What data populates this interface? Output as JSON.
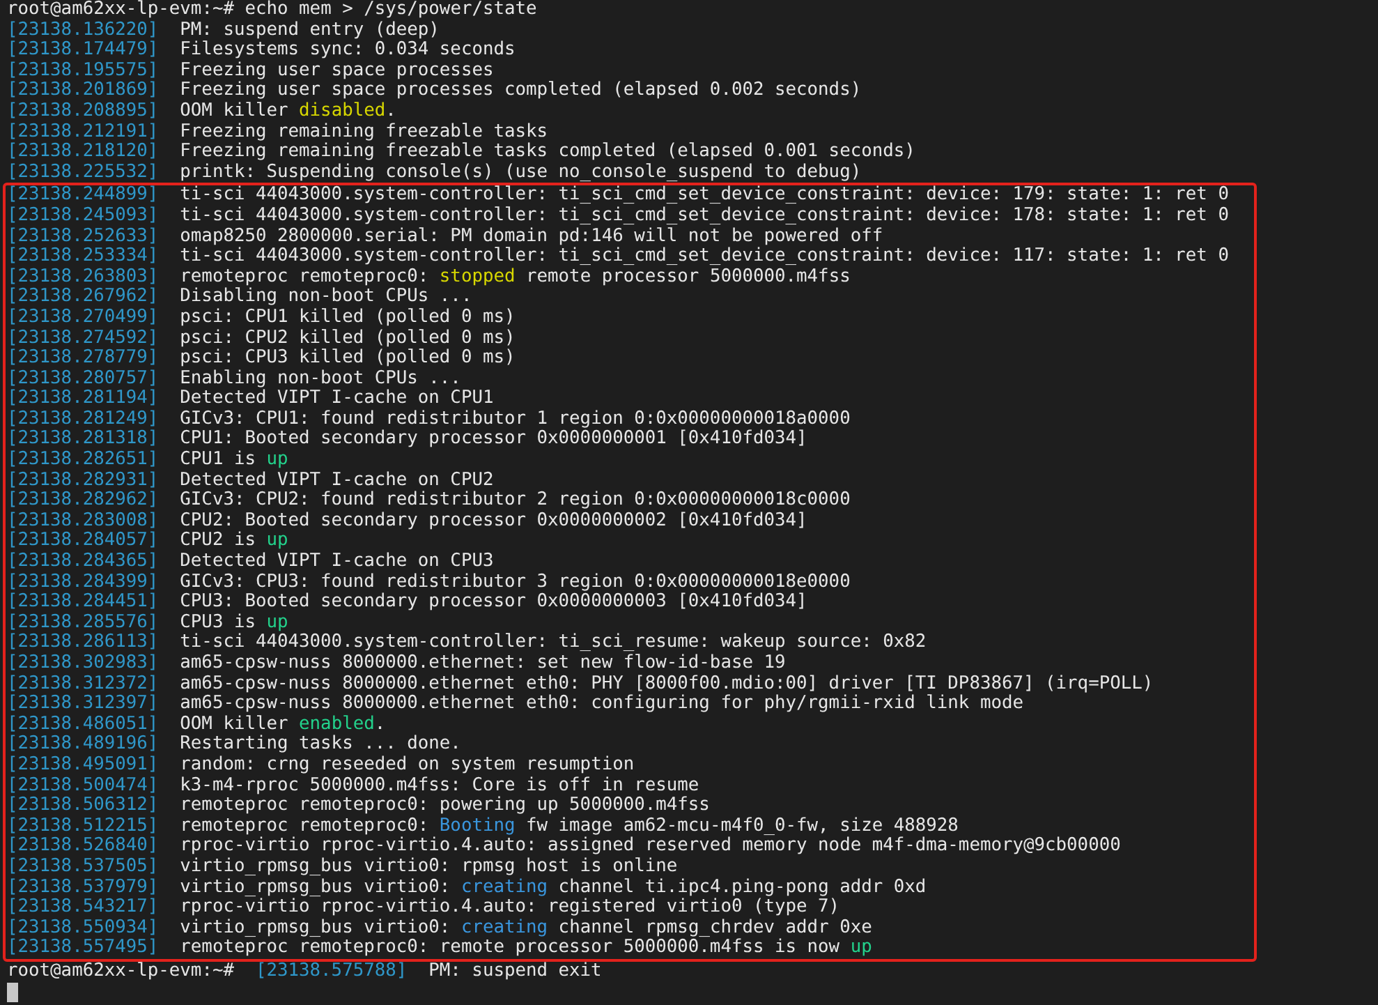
{
  "command_line": {
    "prompt": "root@am62xx-lp-evm:~#",
    "command": "echo mem > /sys/power/state"
  },
  "lines_before": [
    {
      "timestamp": "[23138.136220]",
      "parts": [
        {
          "kind": "plain",
          "text": "PM: suspend entry (deep)"
        }
      ]
    },
    {
      "timestamp": "[23138.174479]",
      "parts": [
        {
          "kind": "plain",
          "text": "Filesystems sync: 0.034 seconds"
        }
      ]
    },
    {
      "timestamp": "[23138.195575]",
      "parts": [
        {
          "kind": "plain",
          "text": "Freezing user space processes"
        }
      ]
    },
    {
      "timestamp": "[23138.201869]",
      "parts": [
        {
          "kind": "plain",
          "text": "Freezing user space processes completed (elapsed 0.002 seconds)"
        }
      ]
    },
    {
      "timestamp": "[23138.208895]",
      "parts": [
        {
          "kind": "plain",
          "text": "OOM killer "
        },
        {
          "kind": "warn",
          "text": "disabled"
        },
        {
          "kind": "plain",
          "text": "."
        }
      ]
    },
    {
      "timestamp": "[23138.212191]",
      "parts": [
        {
          "kind": "plain",
          "text": "Freezing remaining freezable tasks"
        }
      ]
    },
    {
      "timestamp": "[23138.218120]",
      "parts": [
        {
          "kind": "plain",
          "text": "Freezing remaining freezable tasks completed (elapsed 0.001 seconds)"
        }
      ]
    },
    {
      "timestamp": "[23138.225532]",
      "parts": [
        {
          "kind": "plain",
          "text": "printk: Suspending console(s) (use no_console_suspend to debug)"
        }
      ]
    }
  ],
  "highlighted_lines": [
    {
      "timestamp": "[23138.244899]",
      "parts": [
        {
          "kind": "plain",
          "text": "ti-sci 44043000.system-controller: ti_sci_cmd_set_device_constraint: device: 179: state: 1: ret 0"
        }
      ]
    },
    {
      "timestamp": "[23138.245093]",
      "parts": [
        {
          "kind": "plain",
          "text": "ti-sci 44043000.system-controller: ti_sci_cmd_set_device_constraint: device: 178: state: 1: ret 0"
        }
      ]
    },
    {
      "timestamp": "[23138.252633]",
      "parts": [
        {
          "kind": "plain",
          "text": "omap8250 2800000.serial: PM domain pd:146 will not be powered off"
        }
      ]
    },
    {
      "timestamp": "[23138.253334]",
      "parts": [
        {
          "kind": "plain",
          "text": "ti-sci 44043000.system-controller: ti_sci_cmd_set_device_constraint: device: 117: state: 1: ret 0"
        }
      ]
    },
    {
      "timestamp": "[23138.263803]",
      "parts": [
        {
          "kind": "plain",
          "text": "remoteproc remoteproc0: "
        },
        {
          "kind": "warn",
          "text": "stopped"
        },
        {
          "kind": "plain",
          "text": " remote processor 5000000.m4fss"
        }
      ]
    },
    {
      "timestamp": "[23138.267962]",
      "parts": [
        {
          "kind": "plain",
          "text": "Disabling non-boot CPUs ..."
        }
      ]
    },
    {
      "timestamp": "[23138.270499]",
      "parts": [
        {
          "kind": "plain",
          "text": "psci: CPU1 killed (polled 0 ms)"
        }
      ]
    },
    {
      "timestamp": "[23138.274592]",
      "parts": [
        {
          "kind": "plain",
          "text": "psci: CPU2 killed (polled 0 ms)"
        }
      ]
    },
    {
      "timestamp": "[23138.278779]",
      "parts": [
        {
          "kind": "plain",
          "text": "psci: CPU3 killed (polled 0 ms)"
        }
      ]
    },
    {
      "timestamp": "[23138.280757]",
      "parts": [
        {
          "kind": "plain",
          "text": "Enabling non-boot CPUs ..."
        }
      ]
    },
    {
      "timestamp": "[23138.281194]",
      "parts": [
        {
          "kind": "plain",
          "text": "Detected VIPT I-cache on CPU1"
        }
      ]
    },
    {
      "timestamp": "[23138.281249]",
      "parts": [
        {
          "kind": "plain",
          "text": "GICv3: CPU1: found redistributor 1 region 0:0x00000000018a0000"
        }
      ]
    },
    {
      "timestamp": "[23138.281318]",
      "parts": [
        {
          "kind": "plain",
          "text": "CPU1: Booted secondary processor 0x0000000001 [0x410fd034]"
        }
      ]
    },
    {
      "timestamp": "[23138.282651]",
      "parts": [
        {
          "kind": "plain",
          "text": "CPU1 is "
        },
        {
          "kind": "good",
          "text": "up"
        }
      ]
    },
    {
      "timestamp": "[23138.282931]",
      "parts": [
        {
          "kind": "plain",
          "text": "Detected VIPT I-cache on CPU2"
        }
      ]
    },
    {
      "timestamp": "[23138.282962]",
      "parts": [
        {
          "kind": "plain",
          "text": "GICv3: CPU2: found redistributor 2 region 0:0x00000000018c0000"
        }
      ]
    },
    {
      "timestamp": "[23138.283008]",
      "parts": [
        {
          "kind": "plain",
          "text": "CPU2: Booted secondary processor 0x0000000002 [0x410fd034]"
        }
      ]
    },
    {
      "timestamp": "[23138.284057]",
      "parts": [
        {
          "kind": "plain",
          "text": "CPU2 is "
        },
        {
          "kind": "good",
          "text": "up"
        }
      ]
    },
    {
      "timestamp": "[23138.284365]",
      "parts": [
        {
          "kind": "plain",
          "text": "Detected VIPT I-cache on CPU3"
        }
      ]
    },
    {
      "timestamp": "[23138.284399]",
      "parts": [
        {
          "kind": "plain",
          "text": "GICv3: CPU3: found redistributor 3 region 0:0x00000000018e0000"
        }
      ]
    },
    {
      "timestamp": "[23138.284451]",
      "parts": [
        {
          "kind": "plain",
          "text": "CPU3: Booted secondary processor 0x0000000003 [0x410fd034]"
        }
      ]
    },
    {
      "timestamp": "[23138.285576]",
      "parts": [
        {
          "kind": "plain",
          "text": "CPU3 is "
        },
        {
          "kind": "good",
          "text": "up"
        }
      ]
    },
    {
      "timestamp": "[23138.286113]",
      "parts": [
        {
          "kind": "plain",
          "text": "ti-sci 44043000.system-controller: ti_sci_resume: wakeup source: 0x82"
        }
      ]
    },
    {
      "timestamp": "[23138.302983]",
      "parts": [
        {
          "kind": "plain",
          "text": "am65-cpsw-nuss 8000000.ethernet: set new flow-id-base 19"
        }
      ]
    },
    {
      "timestamp": "[23138.312372]",
      "parts": [
        {
          "kind": "plain",
          "text": "am65-cpsw-nuss 8000000.ethernet eth0: PHY [8000f00.mdio:00] driver [TI DP83867] (irq=POLL)"
        }
      ]
    },
    {
      "timestamp": "[23138.312397]",
      "parts": [
        {
          "kind": "plain",
          "text": "am65-cpsw-nuss 8000000.ethernet eth0: configuring for phy/rgmii-rxid link mode"
        }
      ]
    },
    {
      "timestamp": "[23138.486051]",
      "parts": [
        {
          "kind": "plain",
          "text": "OOM killer "
        },
        {
          "kind": "good",
          "text": "enabled"
        },
        {
          "kind": "plain",
          "text": "."
        }
      ]
    },
    {
      "timestamp": "[23138.489196]",
      "parts": [
        {
          "kind": "plain",
          "text": "Restarting tasks ... done."
        }
      ]
    },
    {
      "timestamp": "[23138.495091]",
      "parts": [
        {
          "kind": "plain",
          "text": "random: crng reseeded on system resumption"
        }
      ]
    },
    {
      "timestamp": "[23138.500474]",
      "parts": [
        {
          "kind": "plain",
          "text": "k3-m4-rproc 5000000.m4fss: Core is off in resume"
        }
      ]
    },
    {
      "timestamp": "[23138.506312]",
      "parts": [
        {
          "kind": "plain",
          "text": "remoteproc remoteproc0: powering up 5000000.m4fss"
        }
      ]
    },
    {
      "timestamp": "[23138.512215]",
      "parts": [
        {
          "kind": "plain",
          "text": "remoteproc remoteproc0: "
        },
        {
          "kind": "info",
          "text": "Booting"
        },
        {
          "kind": "plain",
          "text": " fw image am62-mcu-m4f0_0-fw, size 488928"
        }
      ]
    },
    {
      "timestamp": "[23138.526840]",
      "parts": [
        {
          "kind": "plain",
          "text": "rproc-virtio rproc-virtio.4.auto: assigned reserved memory node m4f-dma-memory@9cb00000"
        }
      ]
    },
    {
      "timestamp": "[23138.537505]",
      "parts": [
        {
          "kind": "plain",
          "text": "virtio_rpmsg_bus virtio0: rpmsg host is online"
        }
      ]
    },
    {
      "timestamp": "[23138.537979]",
      "parts": [
        {
          "kind": "plain",
          "text": "virtio_rpmsg_bus virtio0: "
        },
        {
          "kind": "info",
          "text": "creating"
        },
        {
          "kind": "plain",
          "text": " channel ti.ipc4.ping-pong addr 0xd"
        }
      ]
    },
    {
      "timestamp": "[23138.543217]",
      "parts": [
        {
          "kind": "plain",
          "text": "rproc-virtio rproc-virtio.4.auto: registered virtio0 (type 7)"
        }
      ]
    },
    {
      "timestamp": "[23138.550934]",
      "parts": [
        {
          "kind": "plain",
          "text": "virtio_rpmsg_bus virtio0: "
        },
        {
          "kind": "info",
          "text": "creating"
        },
        {
          "kind": "plain",
          "text": " channel rpmsg_chrdev addr 0xe"
        }
      ]
    },
    {
      "timestamp": "[23138.557495]",
      "parts": [
        {
          "kind": "plain",
          "text": "remoteproc remoteproc0: remote processor 5000000.m4fss is now "
        },
        {
          "kind": "good",
          "text": "up"
        }
      ]
    }
  ],
  "final_line": {
    "prompt": "root@am62xx-lp-evm:~#",
    "timestamp": "[23138.575788]",
    "message": "PM: suspend exit"
  }
}
